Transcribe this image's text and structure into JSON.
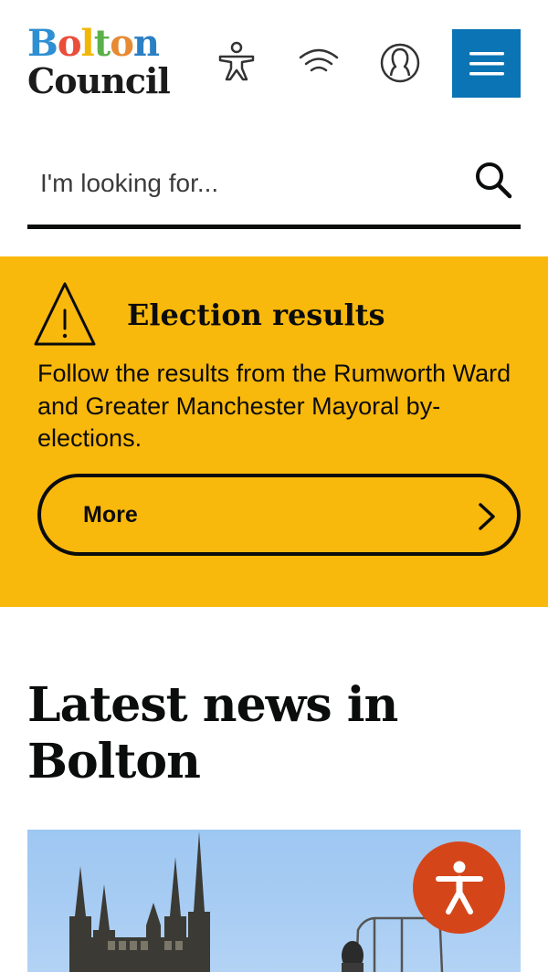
{
  "header": {
    "logo": {
      "line1_letters": [
        {
          "char": "B",
          "color": "#2e8fd3"
        },
        {
          "char": "o",
          "color": "#e94e3a"
        },
        {
          "char": "l",
          "color": "#f2b705"
        },
        {
          "char": "t",
          "color": "#5bb04a"
        },
        {
          "char": "o",
          "color": "#e78a34"
        },
        {
          "char": "n",
          "color": "#2b7fc4"
        }
      ],
      "line2": "Council"
    },
    "icons": [
      "accessibility-person-icon",
      "wifi-signal-icon",
      "user-account-icon",
      "hamburger-menu-icon"
    ]
  },
  "search": {
    "placeholder": "I'm looking for...",
    "icon": "search-icon"
  },
  "alert": {
    "background": "#f9b80c",
    "icon": "warning-triangle-icon",
    "title": "Election results",
    "text": "Follow the results from the Rumworth Ward and Greater Manchester Mayoral by-elections.",
    "button_label": "More",
    "button_icon": "chevron-right-icon"
  },
  "news": {
    "heading": "Latest news in Bolton"
  },
  "colors": {
    "accent_blue": "#0b74b4",
    "alert_yellow": "#f9b80c",
    "accessibility_orange": "#d4461a",
    "text_dark": "#0b0c0c"
  },
  "floating": {
    "icon": "accessibility-icon"
  }
}
